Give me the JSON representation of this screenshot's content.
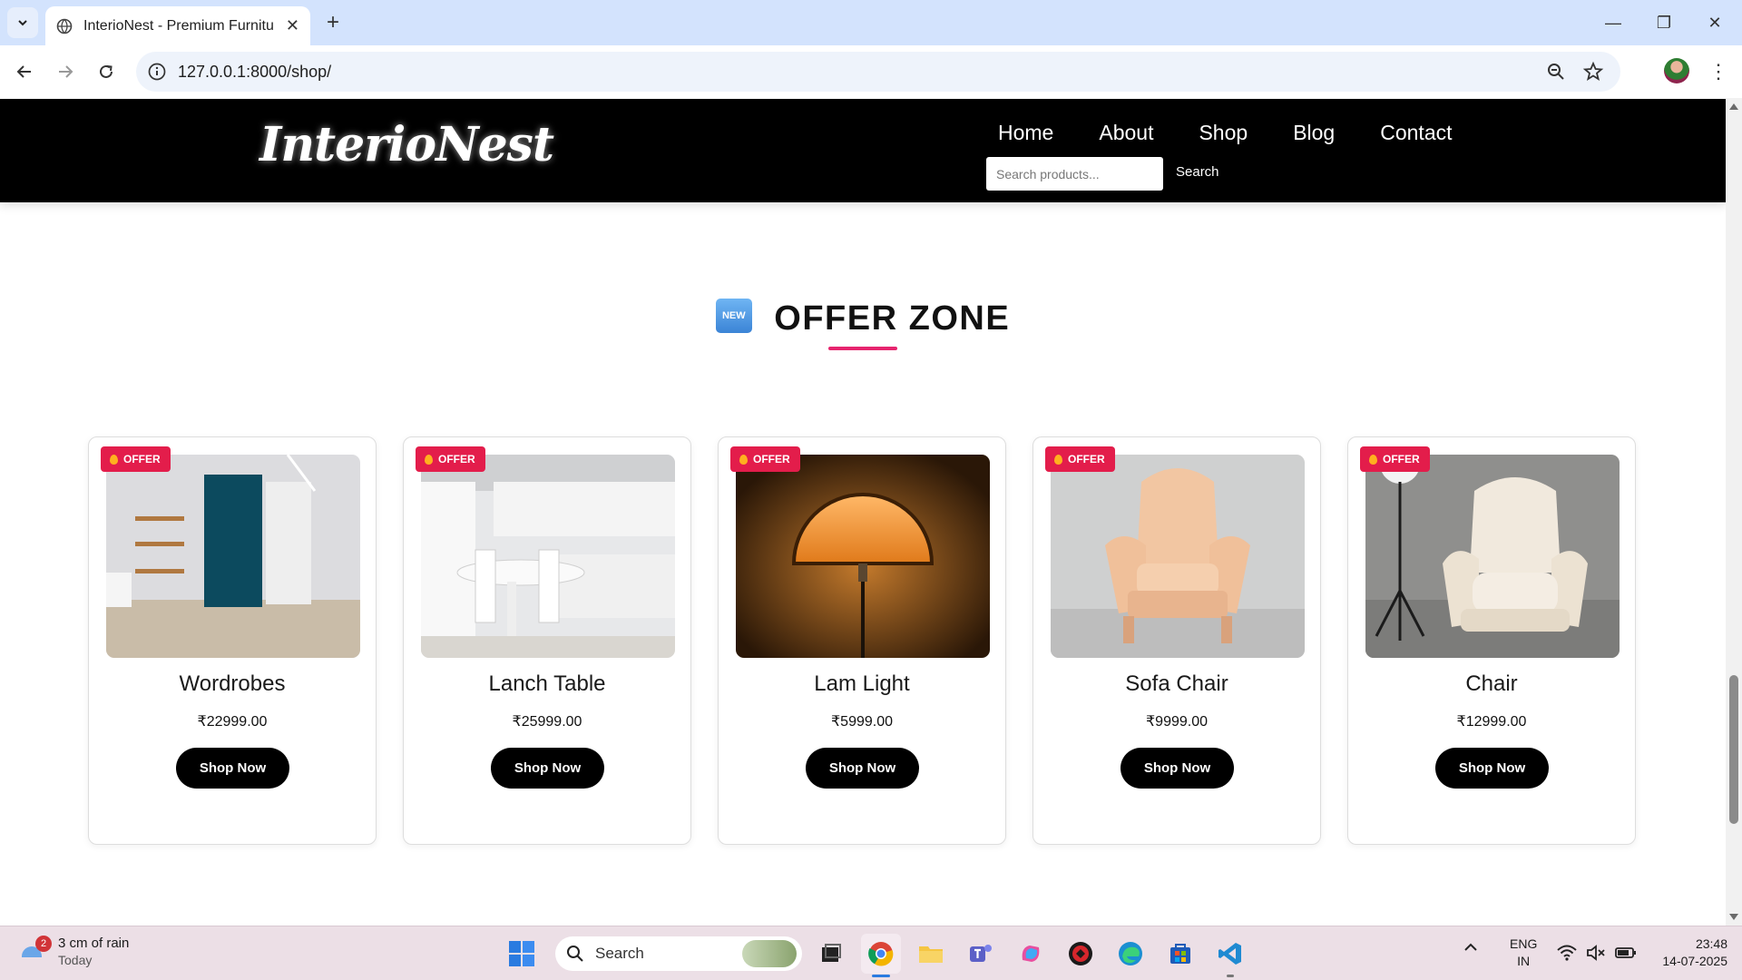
{
  "browser": {
    "tab_title": "InterioNest - Premium Furniture",
    "url": "127.0.0.1:8000/shop/"
  },
  "site": {
    "logo": "InterioNest",
    "nav": [
      "Home",
      "About",
      "Shop",
      "Blog",
      "Contact"
    ],
    "search_placeholder": "Search products...",
    "search_button": "Search"
  },
  "section": {
    "badge": "NEW",
    "title": "OFFER ZONE",
    "accent_color": "#e6246e"
  },
  "products": [
    {
      "badge": "OFFER",
      "name": "Wordrobes",
      "price": "₹22999.00",
      "button": "Shop Now"
    },
    {
      "badge": "OFFER",
      "name": "Lanch Table",
      "price": "₹25999.00",
      "button": "Shop Now"
    },
    {
      "badge": "OFFER",
      "name": "Lam Light",
      "price": "₹5999.00",
      "button": "Shop Now"
    },
    {
      "badge": "OFFER",
      "name": "Sofa Chair",
      "price": "₹9999.00",
      "button": "Shop Now"
    },
    {
      "badge": "OFFER",
      "name": "Chair",
      "price": "₹12999.00",
      "button": "Shop Now"
    }
  ],
  "taskbar": {
    "weather_count": "2",
    "weather_text": "3 cm of rain",
    "weather_sub": "Today",
    "search_label": "Search",
    "lang_1": "ENG",
    "lang_2": "IN",
    "time": "23:48",
    "date": "14-07-2025"
  }
}
